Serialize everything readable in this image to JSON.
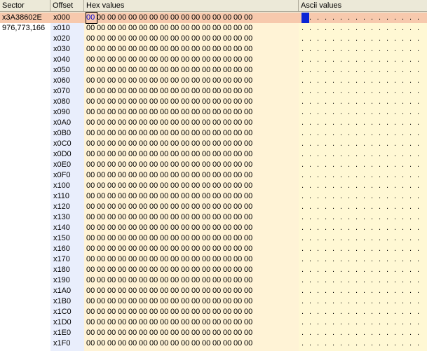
{
  "columns": {
    "sector": "Sector",
    "offset": "Offset",
    "hex": "Hex values",
    "ascii": "Ascii values"
  },
  "sector": {
    "hex": "x3A38602E",
    "decimal": "976,773,166"
  },
  "offsets": [
    "x000",
    "x010",
    "x020",
    "x030",
    "x040",
    "x050",
    "x060",
    "x070",
    "x080",
    "x090",
    "x0A0",
    "x0B0",
    "x0C0",
    "x0D0",
    "x0E0",
    "x0F0",
    "x100",
    "x110",
    "x120",
    "x130",
    "x140",
    "x150",
    "x160",
    "x170",
    "x180",
    "x190",
    "x1A0",
    "x1B0",
    "x1C0",
    "x1D0",
    "x1E0",
    "x1F0"
  ],
  "hex_byte": "00",
  "ascii_char": ".",
  "bytes_per_row": 16,
  "selection": {
    "row": 0,
    "byte": 0
  },
  "colors": {
    "header_bg": "#ece9d8",
    "offset_bg": "#e9eefc",
    "hex_bg": "#fff3d6",
    "ascii_bg": "#fff8d4",
    "current_row": "#f7c9ad",
    "ascii_selection": "#0a24d6"
  }
}
